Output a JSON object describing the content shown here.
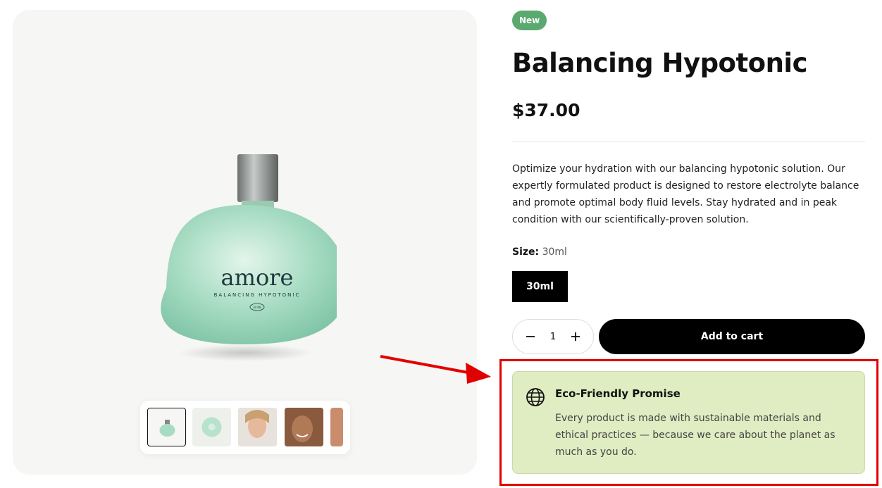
{
  "product": {
    "badge": "New",
    "title": "Balancing Hypotonic",
    "price": "$37.00",
    "description": "Optimize your hydration with our balancing hypotonic solution. Our expertly formulated product is designed to restore electrolyte balance and promote optimal body fluid levels. Stay hydrated and in peak condition with our scientifically-proven solution.",
    "brand_logo": "amore",
    "bottle_label": "BALANCING HYPOTONIC",
    "bottle_volume": "30 ML"
  },
  "size": {
    "label": "Size:",
    "selected": "30ml",
    "options": [
      "30ml"
    ]
  },
  "quantity": {
    "value": "1",
    "minus_icon": "minus-icon",
    "plus_icon": "plus-icon"
  },
  "cart": {
    "label": "Add to cart"
  },
  "eco": {
    "title": "Eco-Friendly Promise",
    "text": "Every product is made with sustainable materials and ethical practices — because we care about the planet as much as you do.",
    "icon": "globe-icon"
  },
  "thumbnails": [
    "bottle-thumb",
    "bottle-top-thumb",
    "model-face-thumb",
    "model-smile-thumb",
    "model-partial-thumb"
  ],
  "colors": {
    "badge": "#5aa96f",
    "eco_bg": "#e0ecc2",
    "highlight": "#e10000",
    "accent": "#000000"
  }
}
